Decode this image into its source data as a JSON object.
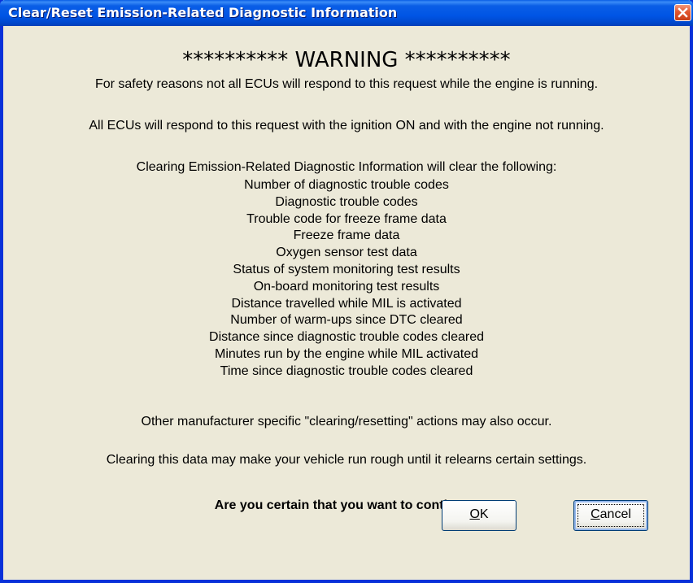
{
  "window": {
    "title": "Clear/Reset Emission-Related Diagnostic Information",
    "close_icon": "close-icon"
  },
  "dialog": {
    "warning": "********** WARNING **********",
    "safety_line": "For safety reasons not all ECUs will respond to this request while the engine is running.",
    "ignition_line": "All ECUs will respond to this request with the ignition ON and with the engine not running.",
    "intro_line": "Clearing Emission-Related Diagnostic Information will clear the following:",
    "items": [
      "Number of diagnostic trouble codes",
      "Diagnostic trouble codes",
      "Trouble code for freeze frame data",
      "Freeze frame data",
      "Oxygen sensor test data",
      "Status of system monitoring test results",
      "On-board monitoring test results",
      "Distance travelled while MIL is activated",
      "Number of warm-ups since DTC cleared",
      "Distance since diagnostic trouble codes cleared",
      "Minutes run by the engine while MIL activated",
      "Time since diagnostic trouble codes cleared"
    ],
    "manufacturer_line": "Other manufacturer specific \"clearing/resetting\" actions may also occur.",
    "rough_line": "Clearing this data may make your vehicle run rough until it relearns certain settings.",
    "question": "Are you certain that you want to continue?"
  },
  "buttons": {
    "ok_mnemonic": "O",
    "ok_rest": "K",
    "cancel_mnemonic": "C",
    "cancel_rest": "ancel"
  },
  "colors": {
    "titlebar": "#0055e5",
    "frame": "#0831d9",
    "dialog_bg": "#ece9d8",
    "close_button": "#e2562e"
  }
}
